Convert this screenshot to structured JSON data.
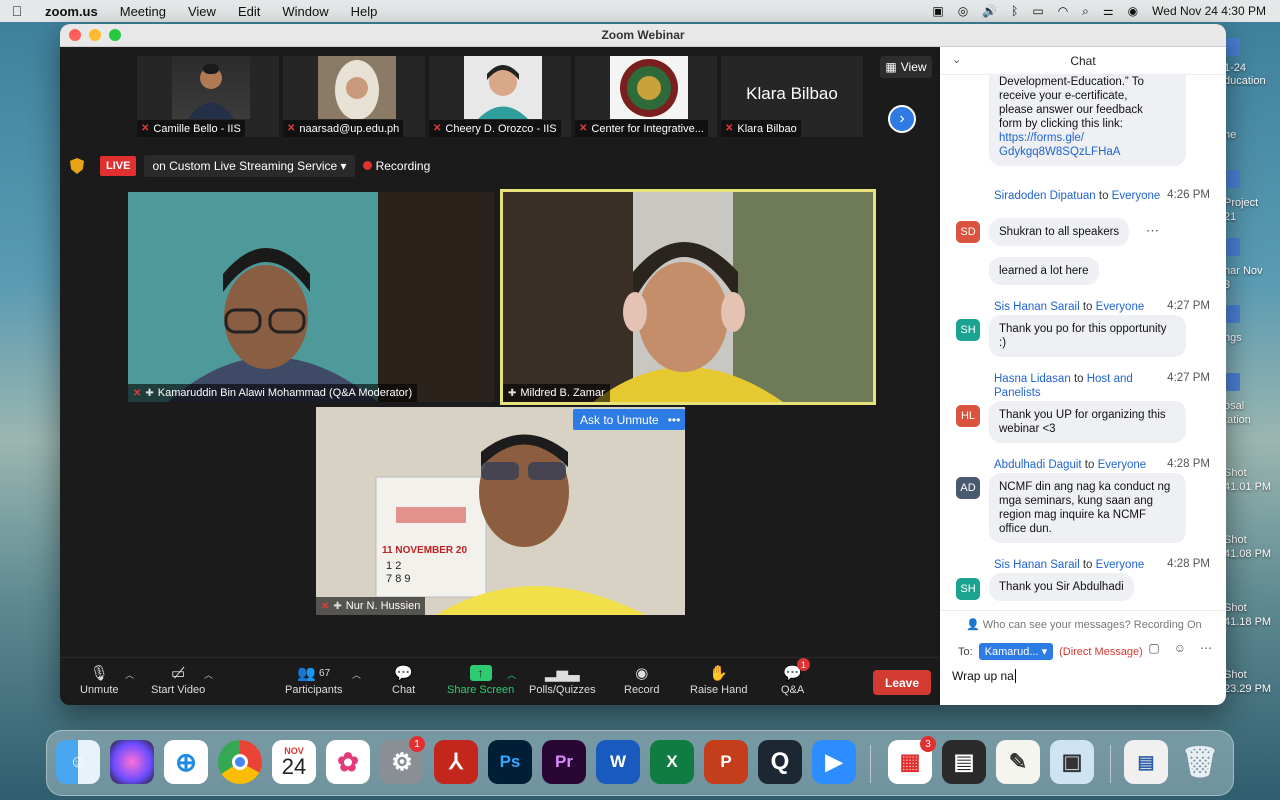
{
  "menubar": {
    "app": "zoom.us",
    "items": [
      "Meeting",
      "View",
      "Edit",
      "Window",
      "Help"
    ],
    "clock": "Wed Nov 24  4:30 PM"
  },
  "desktop_labels": [
    "1-24",
    "ducation",
    "ne",
    "Project",
    "21",
    "nar Nov",
    "3",
    "ngs",
    "osal",
    "tation",
    "Shot",
    "41.01 PM",
    "Shot",
    "41.08 PM",
    "Shot",
    "41.18 PM",
    "Shot",
    "23.29 PM"
  ],
  "window": {
    "title": "Zoom Webinar"
  },
  "thumbnails": [
    {
      "name": "Camille Bello - IIS"
    },
    {
      "name": "naarsad@up.edu.ph"
    },
    {
      "name": "Cheery D. Orozco - IIS"
    },
    {
      "name": "Center for Integrative..."
    },
    {
      "name": "Klara Bilbao",
      "big": "Klara Bilbao"
    }
  ],
  "view_button": "View",
  "livebar": {
    "live": "LIVE",
    "stream": "on Custom Live Streaming Service",
    "recording": "Recording"
  },
  "tiles": {
    "moderator": "Kamaruddin Bin Alawi Mohammad (Q&A Moderator)",
    "speaker": "Mildred B. Zamar",
    "participant": "Nur N. Hussien",
    "ask_to_unmute": "Ask to Unmute",
    "more": "•••",
    "calendar_month": "11 NOVEMBER 20",
    "calendar_days": [
      "1",
      "2",
      "7",
      "8",
      "9"
    ]
  },
  "toolbar": {
    "unmute": "Unmute",
    "start_video": "Start Video",
    "participants": "Participants",
    "participant_count": "67",
    "chat": "Chat",
    "share_screen": "Share Screen",
    "polls": "Polls/Quizzes",
    "record": "Record",
    "raise_hand": "Raise Hand",
    "qa": "Q&A",
    "qa_badge": "1",
    "leave": "Leave"
  },
  "chat": {
    "header": "Chat",
    "top_message": {
      "lines": [
        "Development-Education.”  To",
        "receive your e-certificate,",
        "please answer our feedback",
        "form by clicking this link:"
      ],
      "link1": "https://forms.gle/",
      "link2": "Gdykgq8W8SQzLFHaA"
    },
    "messages": [
      {
        "initials": "SD",
        "color": "#d9533f",
        "from": "Siradoden Dipatuan",
        "to": "Everyone",
        "time": "4:26 PM",
        "texts": [
          "Shukran to all speakers",
          "learned a lot here"
        ]
      },
      {
        "initials": "SH",
        "color": "#19a390",
        "from": "Sis Hanan Sarail",
        "to": "Everyone",
        "time": "4:27 PM",
        "texts": [
          "Thank you po for this opportunity :)"
        ]
      },
      {
        "initials": "HL",
        "color": "#d9533f",
        "from": "Hasna Lidasan",
        "to": "Host and Panelists",
        "time": "4:27 PM",
        "texts": [
          "Thank you UP for organizing this webinar <3"
        ]
      },
      {
        "initials": "AD",
        "color": "#4a5a6e",
        "from": "Abdulhadi Daguit",
        "to": "Everyone",
        "time": "4:28 PM",
        "texts": [
          "NCMF din ang nag ka conduct ng mga seminars, kung saan ang region mag inquire ka NCMF office dun."
        ]
      },
      {
        "initials": "SH",
        "color": "#19a390",
        "from": "Sis Hanan Sarail",
        "to": "Everyone",
        "time": "4:28 PM",
        "texts": [
          "Thank you Sir Abdulhadi"
        ]
      }
    ],
    "to_word": "to",
    "who_can_see": "Who can see your messages? Recording On",
    "to_label": "To:",
    "recipient": "Kamarud...",
    "direct_message": "(Direct Message)",
    "composer_value": "Wrap up na"
  },
  "dock": {
    "calendar_month": "NOV",
    "calendar_day": "24",
    "badges": {
      "settings": "1",
      "office": "3"
    },
    "labels": {
      "ps": "Ps",
      "pr": "Pr",
      "word": "W",
      "excel": "X",
      "ppt": "P"
    }
  }
}
